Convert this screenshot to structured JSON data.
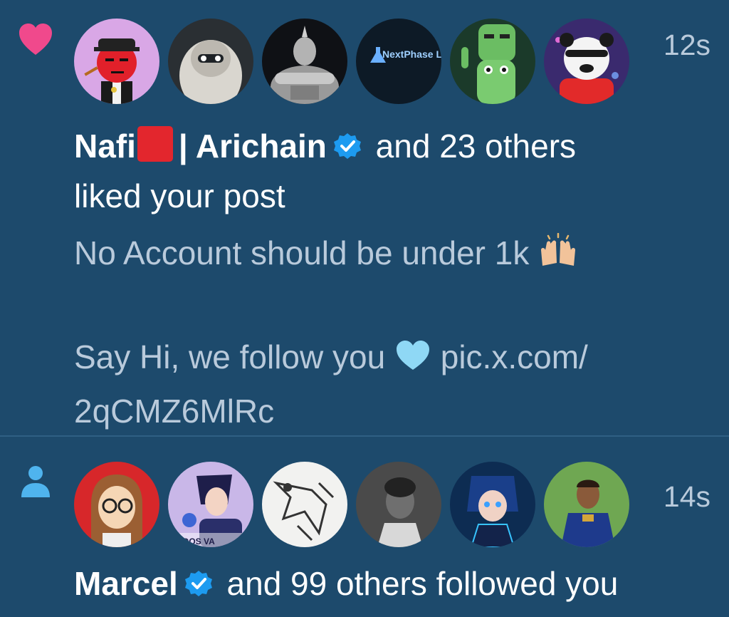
{
  "notifications": [
    {
      "type_icon": "heart-icon",
      "time": "12s",
      "actor_name": "Nafi",
      "actor_name_rest": "| Arichain",
      "action_tail": " and 23 others",
      "action_line2": "liked your post",
      "post_line1": "No Account should be under 1k",
      "post_line2a": "Say Hi, we follow you",
      "post_line2b": "pic.x.com/",
      "post_line3": "2qCMZ6MlRc",
      "avatar_text": "NextPhase Labs",
      "avatars": [
        "avatar-red-character",
        "avatar-hooded-figure",
        "avatar-rhino-muscle",
        "avatar-nextphase-labs",
        "avatar-green-frog",
        "avatar-panda"
      ]
    },
    {
      "type_icon": "person-icon",
      "time": "14s",
      "actor_name": "Marcel",
      "action_tail": " and 99 others followed you",
      "avatar_text": "ERDOS VA",
      "avatars": [
        "avatar-cartoon-glasses",
        "avatar-anime-boy",
        "avatar-sketch",
        "avatar-woman-bw",
        "avatar-anime-blue",
        "avatar-cricket-player"
      ]
    }
  ],
  "colors": {
    "background": "#1d4a6c",
    "heart": "#f0498c",
    "person": "#4fb4ee",
    "verified": "#1d9bf0",
    "muted_text": "#b9cadb"
  }
}
